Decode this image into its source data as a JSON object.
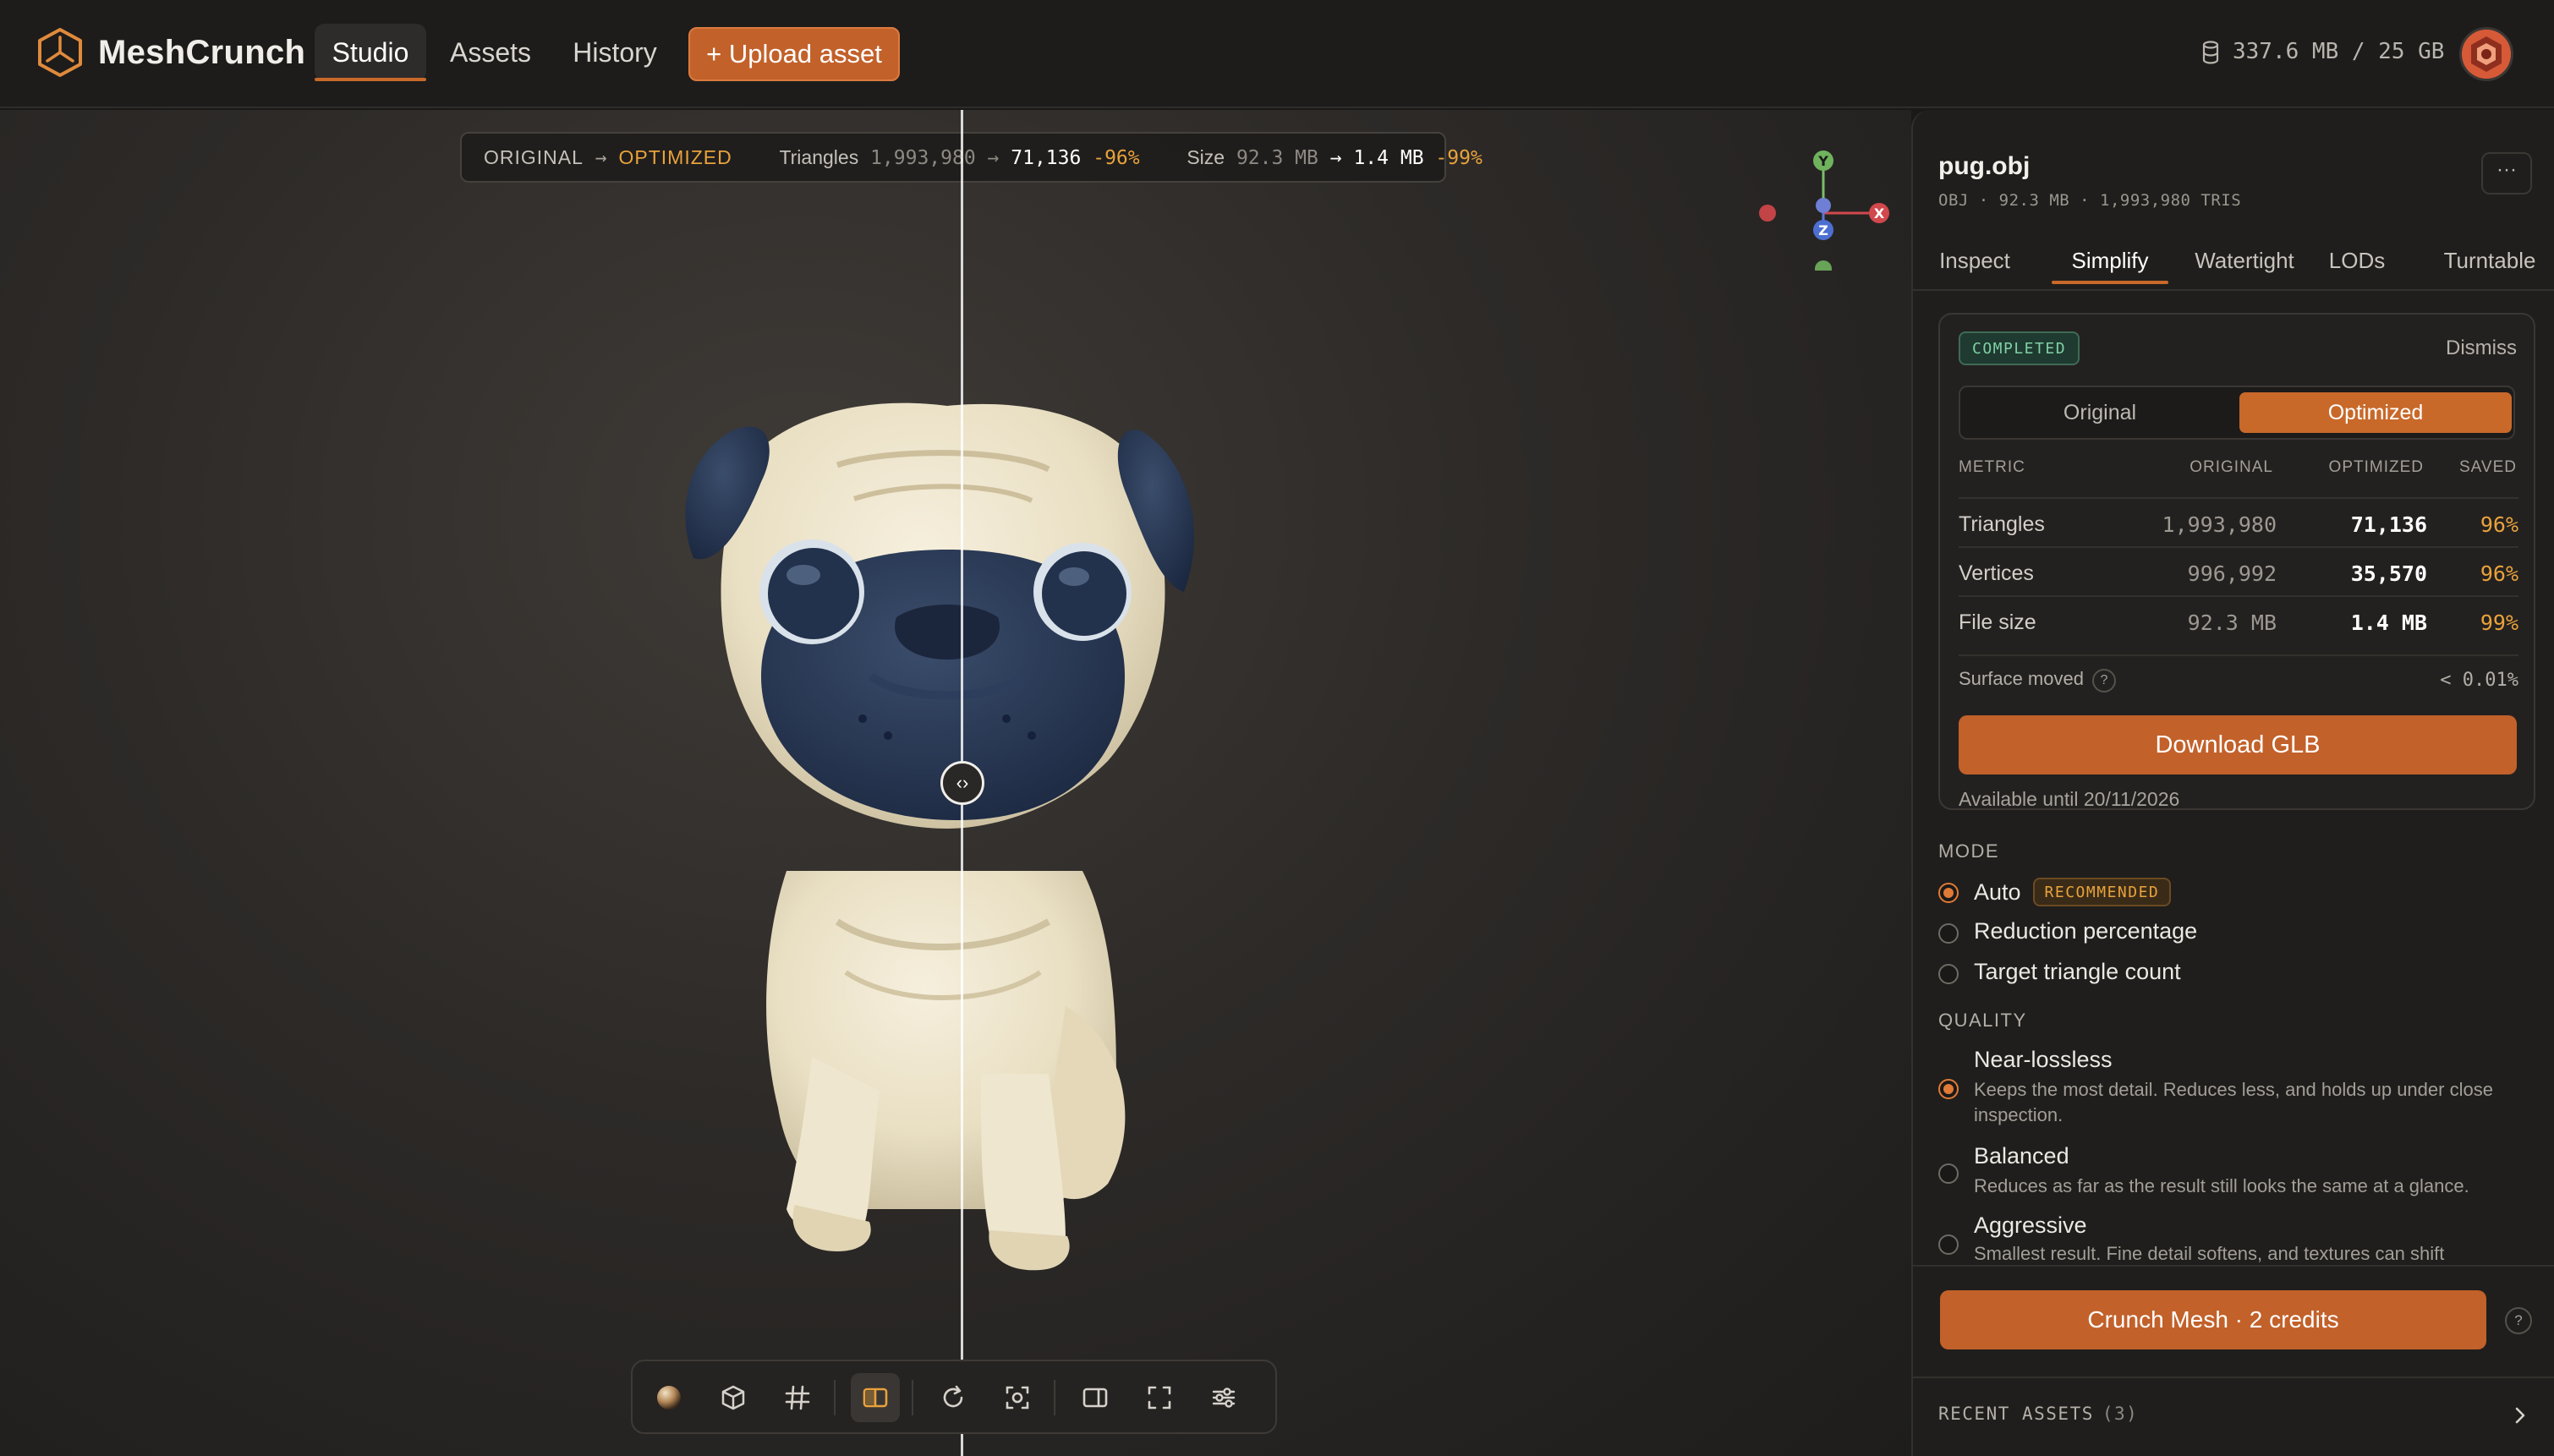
{
  "app": {
    "brand": "MeshCrunch",
    "nav": [
      {
        "label": "Studio",
        "active": true
      },
      {
        "label": "Assets",
        "active": false
      },
      {
        "label": "History",
        "active": false
      }
    ],
    "upload_label": "+ Upload asset",
    "storage": "337.6 MB / 25 GB",
    "accent": "#c2612a"
  },
  "viewport": {
    "stats": {
      "original_label": "ORIGINAL",
      "arrow": "→",
      "optimized_label": "OPTIMIZED",
      "triangles_label": "Triangles",
      "triangles_original": "1,993,980",
      "triangles_optimized": "71,136",
      "triangles_pct": "-96%",
      "size_label": "Size",
      "size_original": "92.3 MB",
      "size_optimized": "1.4 MB",
      "size_pct": "-99%"
    },
    "gizmo": {
      "y": "Y",
      "x": "X",
      "z": "Z"
    },
    "split_handle": "‹›",
    "toolbar": [
      {
        "name": "material-preview-button",
        "icon": "sphere-icon",
        "active": false
      },
      {
        "name": "wireframe-cube-button",
        "icon": "cube-icon",
        "active": false
      },
      {
        "name": "grid-toggle-button",
        "icon": "grid-icon",
        "active": false
      },
      {
        "name": "compare-split-button",
        "icon": "split-view-icon",
        "active": true
      },
      {
        "name": "reset-rotation-button",
        "icon": "rotate-icon",
        "active": false
      },
      {
        "name": "focus-frame-button",
        "icon": "focus-icon",
        "active": false
      },
      {
        "name": "side-panel-toggle-button",
        "icon": "sidebar-icon",
        "active": false
      },
      {
        "name": "fullscreen-button",
        "icon": "fullscreen-icon",
        "active": false
      },
      {
        "name": "view-settings-button",
        "icon": "sliders-icon",
        "active": false
      }
    ]
  },
  "panel": {
    "file_name": "pug.obj",
    "file_meta": "OBJ · 92.3 MB · 1,993,980 TRIS",
    "more_label": "···",
    "tabs": [
      {
        "label": "Inspect",
        "active": false
      },
      {
        "label": "Simplify",
        "active": true
      },
      {
        "label": "Watertight",
        "active": false
      },
      {
        "label": "LODs",
        "active": false
      },
      {
        "label": "Turntable",
        "active": false
      }
    ],
    "result": {
      "status": "COMPLETED",
      "dismiss": "Dismiss",
      "toggle": {
        "original": "Original",
        "optimized": "Optimized",
        "selected": "Optimized"
      },
      "columns": {
        "metric": "METRIC",
        "original": "ORIGINAL",
        "optimized": "OPTIMIZED",
        "saved": "SAVED"
      },
      "rows": [
        {
          "metric": "Triangles",
          "original": "1,993,980",
          "optimized": "71,136",
          "saved": "96%"
        },
        {
          "metric": "Vertices",
          "original": "996,992",
          "optimized": "35,570",
          "saved": "96%"
        },
        {
          "metric": "File size",
          "original": "92.3 MB",
          "optimized": "1.4 MB",
          "saved": "99%"
        }
      ],
      "surface_label": "Surface moved",
      "surface_help": "?",
      "surface_value": "< 0.01%",
      "download_label": "Download GLB",
      "available": "Available until 20/11/2026"
    },
    "mode": {
      "label": "MODE",
      "options": [
        {
          "label": "Auto",
          "badge": "RECOMMENDED",
          "selected": true
        },
        {
          "label": "Reduction percentage",
          "selected": false
        },
        {
          "label": "Target triangle count",
          "selected": false
        }
      ]
    },
    "quality": {
      "label": "QUALITY",
      "options": [
        {
          "label": "Near-lossless",
          "desc": "Keeps the most detail. Reduces less, and holds up under close inspection.",
          "selected": true
        },
        {
          "label": "Balanced",
          "desc": "Reduces as far as the result still looks the same at a glance.",
          "selected": false
        },
        {
          "label": "Aggressive",
          "desc": "Smallest result. Fine detail softens, and textures can shift",
          "selected": false
        }
      ]
    },
    "crunch_label": "Crunch Mesh · 2 credits",
    "crunch_help": "?",
    "recent_label": "RECENT ASSETS",
    "recent_count": "(3)"
  }
}
